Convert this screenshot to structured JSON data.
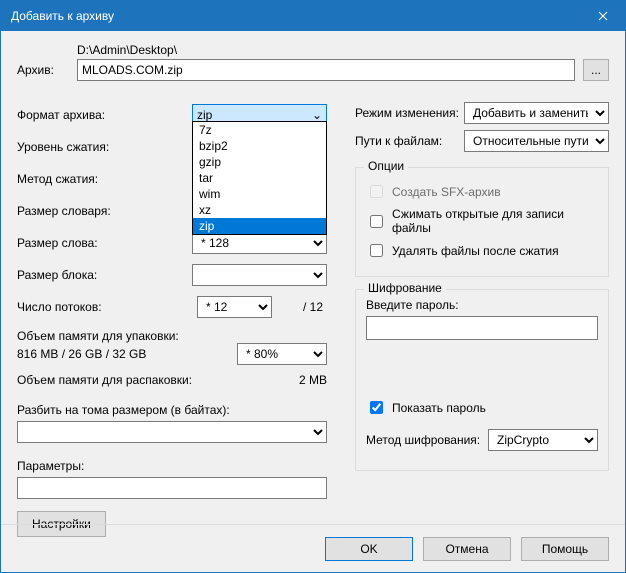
{
  "title": "Добавить к архиву",
  "archive_label": "Архив:",
  "archive_path": "D:\\Admin\\Desktop\\",
  "archive_name": "MLOADS.COM.zip",
  "browse": "...",
  "left": {
    "format_label": "Формат архива:",
    "format_value": "zip",
    "format_options": [
      "7z",
      "bzip2",
      "gzip",
      "tar",
      "wim",
      "xz",
      "zip"
    ],
    "format_selected_index": 6,
    "level_label": "Уровень сжатия:",
    "method_label": "Метод сжатия:",
    "dict_label": "Размер словаря:",
    "word_label": "Размер слова:",
    "word_value": "* 128",
    "block_label": "Размер блока:",
    "threads_label": "Число потоков:",
    "threads_value": "* 12",
    "threads_suffix": "/ 12",
    "mem_pack_label": "Объем памяти для упаковки:",
    "mem_pack_value": "816 MB / 26 GB / 32 GB",
    "percent_value": "* 80%",
    "mem_unpack_label": "Объем памяти для распаковки:",
    "mem_unpack_value": "2 MB",
    "split_label": "Разбить на тома размером (в байтах):",
    "params_label": "Параметры:",
    "settings_btn": "Настройки"
  },
  "right": {
    "mode_label": "Режим изменения:",
    "mode_value": "Добавить и заменить",
    "paths_label": "Пути к файлам:",
    "paths_value": "Относительные пути",
    "options_legend": "Опции",
    "sfx_label": "Создать SFX-архив",
    "compress_open_label": "Сжимать открытые для записи файлы",
    "delete_after_label": "Удалять файлы после сжатия",
    "enc_legend": "Шифрование",
    "pass_label": "Введите пароль:",
    "show_pass_label": "Показать пароль",
    "enc_method_label": "Метод шифрования:",
    "enc_method_value": "ZipCrypto"
  },
  "footer": {
    "ok": "OK",
    "cancel": "Отмена",
    "help": "Помощь"
  }
}
